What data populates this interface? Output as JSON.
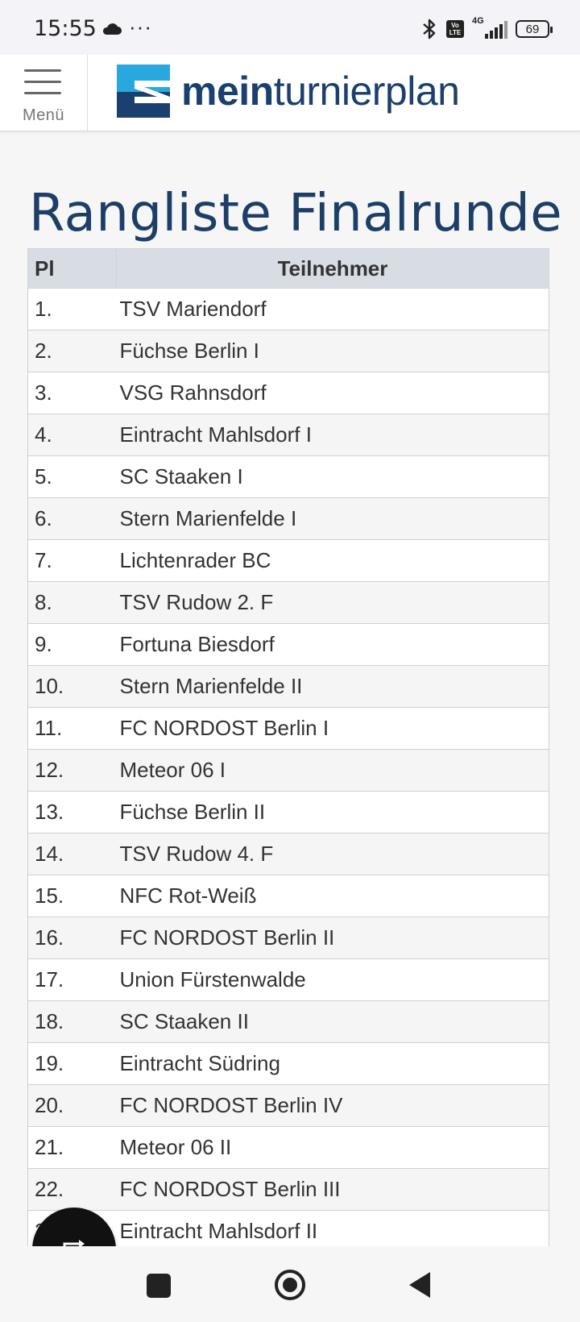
{
  "status_bar": {
    "time": "15:55",
    "more_indicator": "···",
    "network_label": "4G",
    "volte_label": "Vo LTE",
    "battery": "69",
    "icons": [
      "cloud-icon",
      "bluetooth-icon",
      "volte-icon",
      "signal-icon",
      "battery-icon"
    ]
  },
  "header": {
    "menu_label": "Menü",
    "logo_bold": "mein",
    "logo_light": "turnierplan",
    "brand_colors": {
      "dark": "#1b3f6e",
      "light": "#29a8e0"
    }
  },
  "page": {
    "title": "Rangliste Finalrunde"
  },
  "table": {
    "columns": [
      "Pl",
      "Teilnehmer"
    ],
    "rows": [
      {
        "rank": "1.",
        "name": "TSV Mariendorf"
      },
      {
        "rank": "2.",
        "name": "Füchse Berlin I"
      },
      {
        "rank": "3.",
        "name": "VSG Rahnsdorf"
      },
      {
        "rank": "4.",
        "name": "Eintracht Mahlsdorf I"
      },
      {
        "rank": "5.",
        "name": "SC Staaken I"
      },
      {
        "rank": "6.",
        "name": "Stern Marienfelde I"
      },
      {
        "rank": "7.",
        "name": "Lichtenrader BC"
      },
      {
        "rank": "8.",
        "name": "TSV Rudow 2. F"
      },
      {
        "rank": "9.",
        "name": "Fortuna Biesdorf"
      },
      {
        "rank": "10.",
        "name": "Stern Marienfelde II"
      },
      {
        "rank": "11.",
        "name": "FC NORDOST Berlin I"
      },
      {
        "rank": "12.",
        "name": "Meteor 06 I"
      },
      {
        "rank": "13.",
        "name": "Füchse Berlin II"
      },
      {
        "rank": "14.",
        "name": "TSV Rudow 4. F"
      },
      {
        "rank": "15.",
        "name": "NFC Rot-Weiß"
      },
      {
        "rank": "16.",
        "name": "FC NORDOST Berlin II"
      },
      {
        "rank": "17.",
        "name": "Union Fürstenwalde"
      },
      {
        "rank": "18.",
        "name": "SC Staaken II"
      },
      {
        "rank": "19.",
        "name": "Eintracht Südring"
      },
      {
        "rank": "20.",
        "name": "FC NORDOST Berlin IV"
      },
      {
        "rank": "21.",
        "name": "Meteor 06 II"
      },
      {
        "rank": "22.",
        "name": "FC NORDOST Berlin III"
      },
      {
        "rank": "23.",
        "name": "Eintracht Mahlsdorf II"
      }
    ]
  },
  "floating_button": {
    "icon": "repeat-icon"
  },
  "nav_bar": {
    "icons": [
      "recents-square-icon",
      "home-circle-icon",
      "back-triangle-icon"
    ]
  }
}
